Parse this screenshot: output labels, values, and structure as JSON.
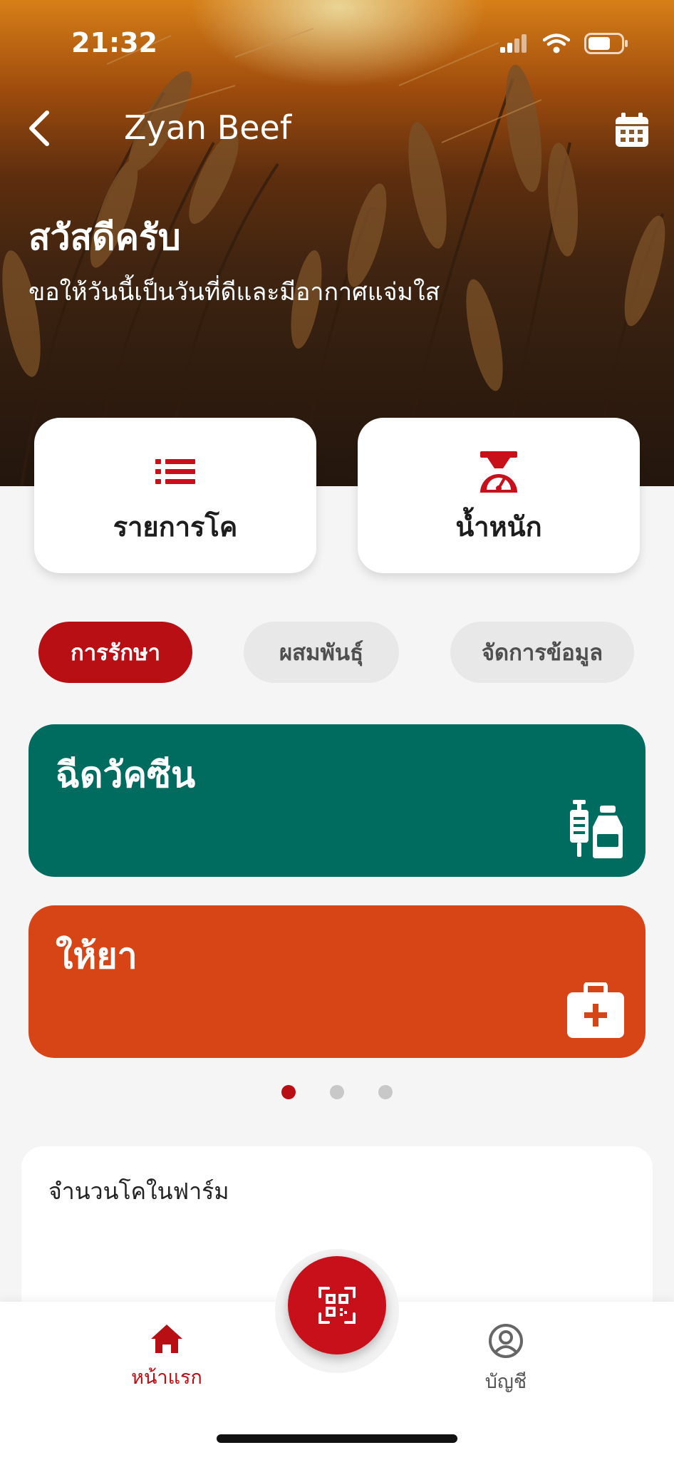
{
  "status_bar": {
    "time": "21:32"
  },
  "header": {
    "title": "Zyan Beef"
  },
  "greeting": {
    "title": "สวัสดีครับ",
    "subtitle": "ขอให้วันนี้เป็นวันที่ดีและมีอากาศแจ่มใส"
  },
  "quick_actions": [
    {
      "label": "รายการโค",
      "icon": "list-icon"
    },
    {
      "label": "น้ำหนัก",
      "icon": "scale-icon"
    }
  ],
  "tabs": [
    {
      "label": "การรักษา",
      "active": true
    },
    {
      "label": "ผสมพันธุ์",
      "active": false
    },
    {
      "label": "จัดการข้อมูล",
      "active": false
    }
  ],
  "cards": [
    {
      "label": "ฉีดวัคซีน",
      "color": "#006c60",
      "icon": "syringe-vaccine-icon"
    },
    {
      "label": "ให้ยา",
      "color": "#d74517",
      "icon": "first-aid-kit-icon"
    }
  ],
  "pager": {
    "pages": 3,
    "current": 1
  },
  "farm_summary": {
    "title": "จำนวนโคในฟาร์ม"
  },
  "bottom_nav": {
    "home_label": "หน้าแรก",
    "account_label": "บัญชี",
    "scan_icon": "qr-scan-icon"
  },
  "colors": {
    "primary": "#b70f14",
    "vaccine": "#006c60",
    "medicine": "#d74517"
  }
}
